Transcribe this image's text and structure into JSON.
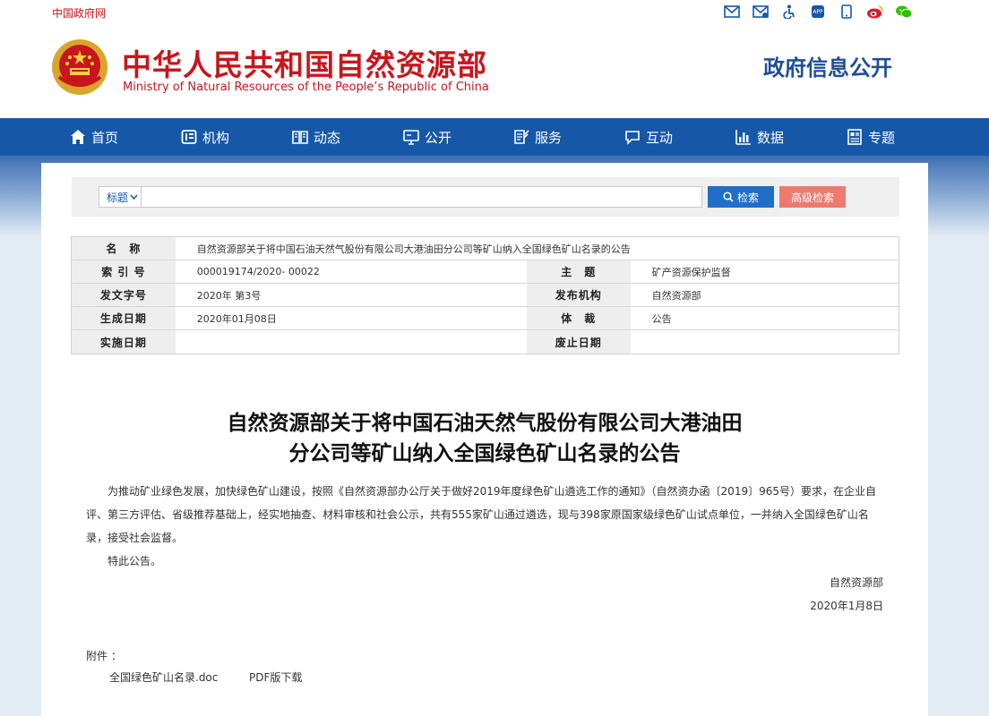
{
  "topbar": {
    "gov_link": "中国政府网"
  },
  "top_icons": [
    "mail-icon",
    "mail-reply-icon",
    "accessibility-icon",
    "app-icon",
    "mobile-icon",
    "weibo-icon",
    "wechat-icon"
  ],
  "header": {
    "title": "中华人民共和国自然资源部",
    "subtitle": "Ministry of Natural Resources of the People’s Republic of China",
    "section": "政府信息公开"
  },
  "nav": [
    {
      "label": "首页",
      "icon": "home-icon"
    },
    {
      "label": "机构",
      "icon": "org-icon"
    },
    {
      "label": "动态",
      "icon": "book-icon"
    },
    {
      "label": "公开",
      "icon": "monitor-icon"
    },
    {
      "label": "服务",
      "icon": "form-icon"
    },
    {
      "label": "互动",
      "icon": "chat-icon"
    },
    {
      "label": "数据",
      "icon": "chart-icon"
    },
    {
      "label": "专题",
      "icon": "topic-icon"
    }
  ],
  "search": {
    "select_value": "标题",
    "input_value": "",
    "search_label": "检索",
    "advanced_label": "高级检索"
  },
  "meta": {
    "name_label": "名　称",
    "name_value": "自然资源部关于将中国石油天然气股份有限公司大港油田分公司等矿山纳入全国绿色矿山名录的公告",
    "index_label": "索 引 号",
    "index_value": "000019174/2020- 00022",
    "topic_label": "主　题",
    "topic_value": "矿产资源保护监督",
    "doc_no_label": "发文字号",
    "doc_no_value": "2020年 第3号",
    "publisher_label": "发布机构",
    "publisher_value": "自然资源部",
    "date_label": "生成日期",
    "date_value": "2020年01月08日",
    "genre_label": "体　裁",
    "genre_value": "公告",
    "impl_label": "实施日期",
    "impl_value": "",
    "expire_label": "废止日期",
    "expire_value": ""
  },
  "doc": {
    "title_line1": "自然资源部关于将中国石油天然气股份有限公司大港油田",
    "title_line2": "分公司等矿山纳入全国绿色矿山名录的公告",
    "para1": "为推动矿业绿色发展，加快绿色矿山建设，按照《自然资源部办公厅关于做好2019年度绿色矿山遴选工作的通知》（自然资办函〔2019〕965号）要求，在企业自评、第三方评估、省级推荐基础上，经实地抽查、材料审核和社会公示，共有555家矿山通过遴选，现与398家原国家级绿色矿山试点单位，一并纳入全国绿色矿山名录，接受社会监督。",
    "para2": "特此公告。",
    "signer": "自然资源部",
    "sign_date": "2020年1月8日",
    "attach_label": "附件 ：",
    "attach_file": "全国绿色矿山名录.doc",
    "attach_pdf": "PDF版下载"
  }
}
